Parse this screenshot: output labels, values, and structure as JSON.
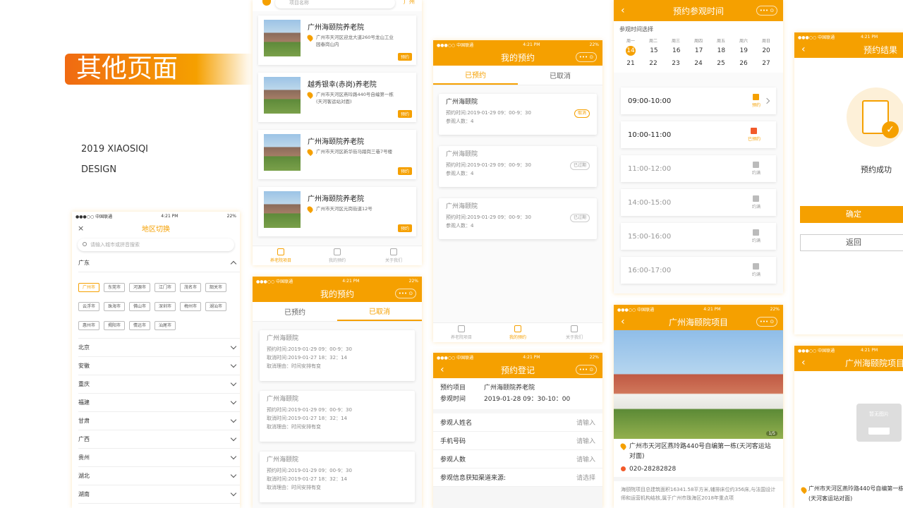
{
  "banner": {
    "title": "其他页面",
    "line1": "2019 XIAOSIQI",
    "line2": "DESIGN"
  },
  "status": {
    "carrier": "●●●○○ 中国联通",
    "time": "4:21 PM",
    "battery": "22%"
  },
  "pill": "••• ⊙",
  "region": {
    "nav_title": "地区切换",
    "close": "×",
    "search_placeholder": "请输入城市或拼音搜索",
    "guangdong": "广东",
    "cities": [
      "广州市",
      "东莞市",
      "河源市",
      "江门市",
      "茂名市",
      "韶关市",
      "云浮市",
      "珠海市",
      "佛山市",
      "深圳市",
      "梅州市",
      "湖汕市",
      "惠州市",
      "揭阳市",
      "情远市",
      "汕尾市"
    ],
    "provinces": [
      "北京",
      "安徽",
      "重庆",
      "福建",
      "甘肃",
      "广西",
      "贵州",
      "湖北",
      "湖南"
    ]
  },
  "list": {
    "search_placeholder": "项目名称",
    "loc": "广州",
    "book": "预约",
    "items": [
      {
        "name": "广州海颐院养老院",
        "addr": "广州市天河区迎龙大道260号龙山工业园春岗山内"
      },
      {
        "name": "越秀银幸(赤岗)养老院",
        "addr": "广州市天河区燕玲路440号自编第一栋(天河客运站对面)"
      },
      {
        "name": "广州海颐院养老院",
        "addr": "广州市天河区新华街马踏岗三巷7号楼"
      },
      {
        "name": "广州海颐院养老院",
        "addr": "广州市天河区元岗街道12号"
      }
    ],
    "tabs": [
      "养老院项目",
      "我的预约",
      "关于我们"
    ]
  },
  "mybook": {
    "title": "我的预约",
    "tab1": "已预约",
    "tab2": "已取消",
    "org": "广州海颐院",
    "time": "预约时间:2019-01-29  09：00-9：30",
    "people": "参观人数：4",
    "cancel_time": "取消时间:2019-01-27  18：32：14",
    "reason": "取消理由：时间安排有变",
    "cancel": "取消",
    "expired": "已过期"
  },
  "register": {
    "title": "预约登记",
    "proj_label": "预约项目",
    "proj": "广州海颐院养老院",
    "time_label": "参观时间",
    "time": "2019-01-28  09：30-10：00",
    "fields": [
      {
        "l": "参观人姓名",
        "v": "请输入"
      },
      {
        "l": "手机号码",
        "v": "请输入"
      },
      {
        "l": "参观人数",
        "v": "请输入"
      },
      {
        "l": "参观信息获知渠道来源:",
        "v": "请选择"
      }
    ]
  },
  "visit": {
    "title": "预约参观时间",
    "label": "参观时间选择",
    "week": [
      "周一",
      "周二",
      "周三",
      "周四",
      "周五",
      "周六",
      "周日"
    ],
    "days1": [
      "14",
      "15",
      "16",
      "17",
      "18",
      "19",
      "20"
    ],
    "days2": [
      "21",
      "22",
      "23",
      "24",
      "25",
      "26",
      "27"
    ],
    "slots": [
      {
        "t": "09:00-10:00",
        "s": "预约",
        "k": "o"
      },
      {
        "t": "10:00-11:00",
        "s": "已预约",
        "k": "r"
      },
      {
        "t": "11:00-12:00",
        "s": "约满",
        "k": "g"
      },
      {
        "t": "14:00-15:00",
        "s": "约满",
        "k": "g"
      },
      {
        "t": "15:00-16:00",
        "s": "约满",
        "k": "g"
      },
      {
        "t": "16:00-17:00",
        "s": "约满",
        "k": "g"
      }
    ]
  },
  "detail": {
    "title": "广州海颐院项目",
    "page": "1/5",
    "addr": "广州市天河区燕玲路440号自编第一栋(天河客运站对面)",
    "phone": "020-28282828",
    "desc": "海颐院项目总建筑面积16341.58平方米,辅排床位约356床,与法国设计师和运营机构结核,属于广州市珠海区2018年重点项"
  },
  "result": {
    "title": "预约结果",
    "msg": "预约成功",
    "ok": "确定",
    "back": "返回"
  },
  "detail2": {
    "title": "广州海颐院项目",
    "noimg": "暂无图片",
    "addr": "广州市天河区燕玲路440号自编第一栋(天河客运站对面)"
  }
}
